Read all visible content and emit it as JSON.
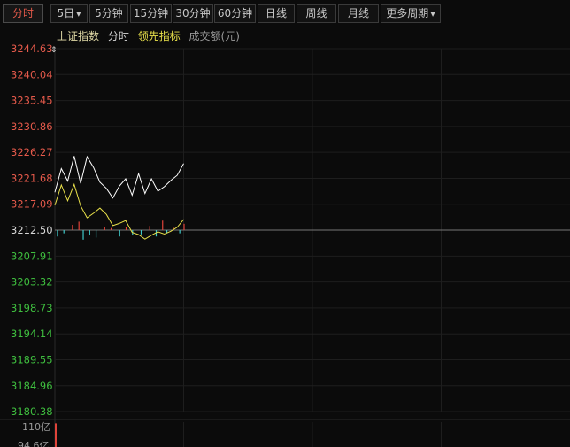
{
  "toolbar": {
    "tabs": [
      {
        "label": "分时",
        "active": true
      },
      {
        "label": "5日",
        "dropdown": true
      },
      {
        "label": "5分钟"
      },
      {
        "label": "15分钟"
      },
      {
        "label": "30分钟"
      },
      {
        "label": "60分钟"
      },
      {
        "label": "日线"
      },
      {
        "label": "周线"
      },
      {
        "label": "月线"
      },
      {
        "label": "更多周期",
        "dropdown": true
      }
    ]
  },
  "legend": {
    "index_name": "上证指数",
    "fenshi": "分时",
    "leading": "领先指标",
    "volume": "成交额(元)"
  },
  "colors": {
    "background": "#0b0b0b",
    "grid": "#1e1e1e",
    "up": "#e65a4b",
    "down": "#3fbf3f",
    "price_line": "#ffffff",
    "leading_line": "#e8e04a",
    "tick_up": "#e0443a",
    "tick_down": "#3fc8c8",
    "zero_line": "#777777"
  },
  "chart_data": {
    "type": "line",
    "prev_close": 3212.5,
    "ylim": [
      3180.38,
      3244.63
    ],
    "y_tick_labels": [
      "3244.63",
      "3240.04",
      "3235.45",
      "3230.86",
      "3226.27",
      "3221.68",
      "3217.09",
      "3212.50",
      "3207.91",
      "3203.32",
      "3198.73",
      "3194.14",
      "3189.55",
      "3184.96",
      "3180.38"
    ],
    "y_tick_values": [
      3244.63,
      3240.04,
      3235.45,
      3230.86,
      3226.27,
      3221.68,
      3217.09,
      3212.5,
      3207.91,
      3203.32,
      3198.73,
      3194.14,
      3189.55,
      3184.96,
      3180.38
    ],
    "x_total_minutes": 240,
    "series": [
      {
        "key": "price",
        "x": [
          0,
          3,
          6,
          9,
          12,
          15,
          18,
          21,
          24,
          27,
          30,
          33,
          36,
          39,
          42,
          45,
          48,
          51,
          54,
          57,
          60
        ],
        "values": [
          3219.2,
          3223.4,
          3221.2,
          3225.6,
          3220.8,
          3225.5,
          3223.6,
          3221.0,
          3219.9,
          3218.2,
          3220.3,
          3221.6,
          3218.7,
          3222.5,
          3219.0,
          3221.6,
          3219.4,
          3220.2,
          3221.3,
          3222.2,
          3224.3
        ]
      },
      {
        "key": "leading",
        "x": [
          0,
          3,
          6,
          9,
          12,
          15,
          18,
          21,
          24,
          27,
          30,
          33,
          36,
          39,
          42,
          45,
          48,
          51,
          54,
          57,
          60
        ],
        "values": [
          3216.9,
          3220.5,
          3217.7,
          3220.6,
          3216.8,
          3214.7,
          3215.5,
          3216.4,
          3215.3,
          3213.3,
          3213.7,
          3214.2,
          3212.1,
          3211.7,
          3210.9,
          3211.6,
          3212.2,
          3211.8,
          3212.3,
          3213.0,
          3214.4
        ]
      }
    ],
    "ticks": [
      {
        "x": 1,
        "v": -0.6
      },
      {
        "x": 4,
        "v": -0.3
      },
      {
        "x": 8,
        "v": 0.5
      },
      {
        "x": 11,
        "v": 0.8
      },
      {
        "x": 13,
        "v": -0.9
      },
      {
        "x": 16,
        "v": -0.5
      },
      {
        "x": 19,
        "v": -0.7
      },
      {
        "x": 23,
        "v": 0.3
      },
      {
        "x": 26,
        "v": 0.2
      },
      {
        "x": 30,
        "v": -0.6
      },
      {
        "x": 33,
        "v": 0.3
      },
      {
        "x": 36,
        "v": -0.5
      },
      {
        "x": 40,
        "v": -0.4
      },
      {
        "x": 44,
        "v": 0.4
      },
      {
        "x": 47,
        "v": -0.6
      },
      {
        "x": 50,
        "v": 0.9
      },
      {
        "x": 52,
        "v": -0.3
      },
      {
        "x": 55,
        "v": 0.3
      },
      {
        "x": 58,
        "v": -0.3
      },
      {
        "x": 60,
        "v": 0.6
      }
    ],
    "volume_panel": {
      "labels": [
        "110亿",
        "94.6亿"
      ],
      "bars": [
        {
          "x": 0,
          "v": 0.95
        }
      ]
    }
  }
}
